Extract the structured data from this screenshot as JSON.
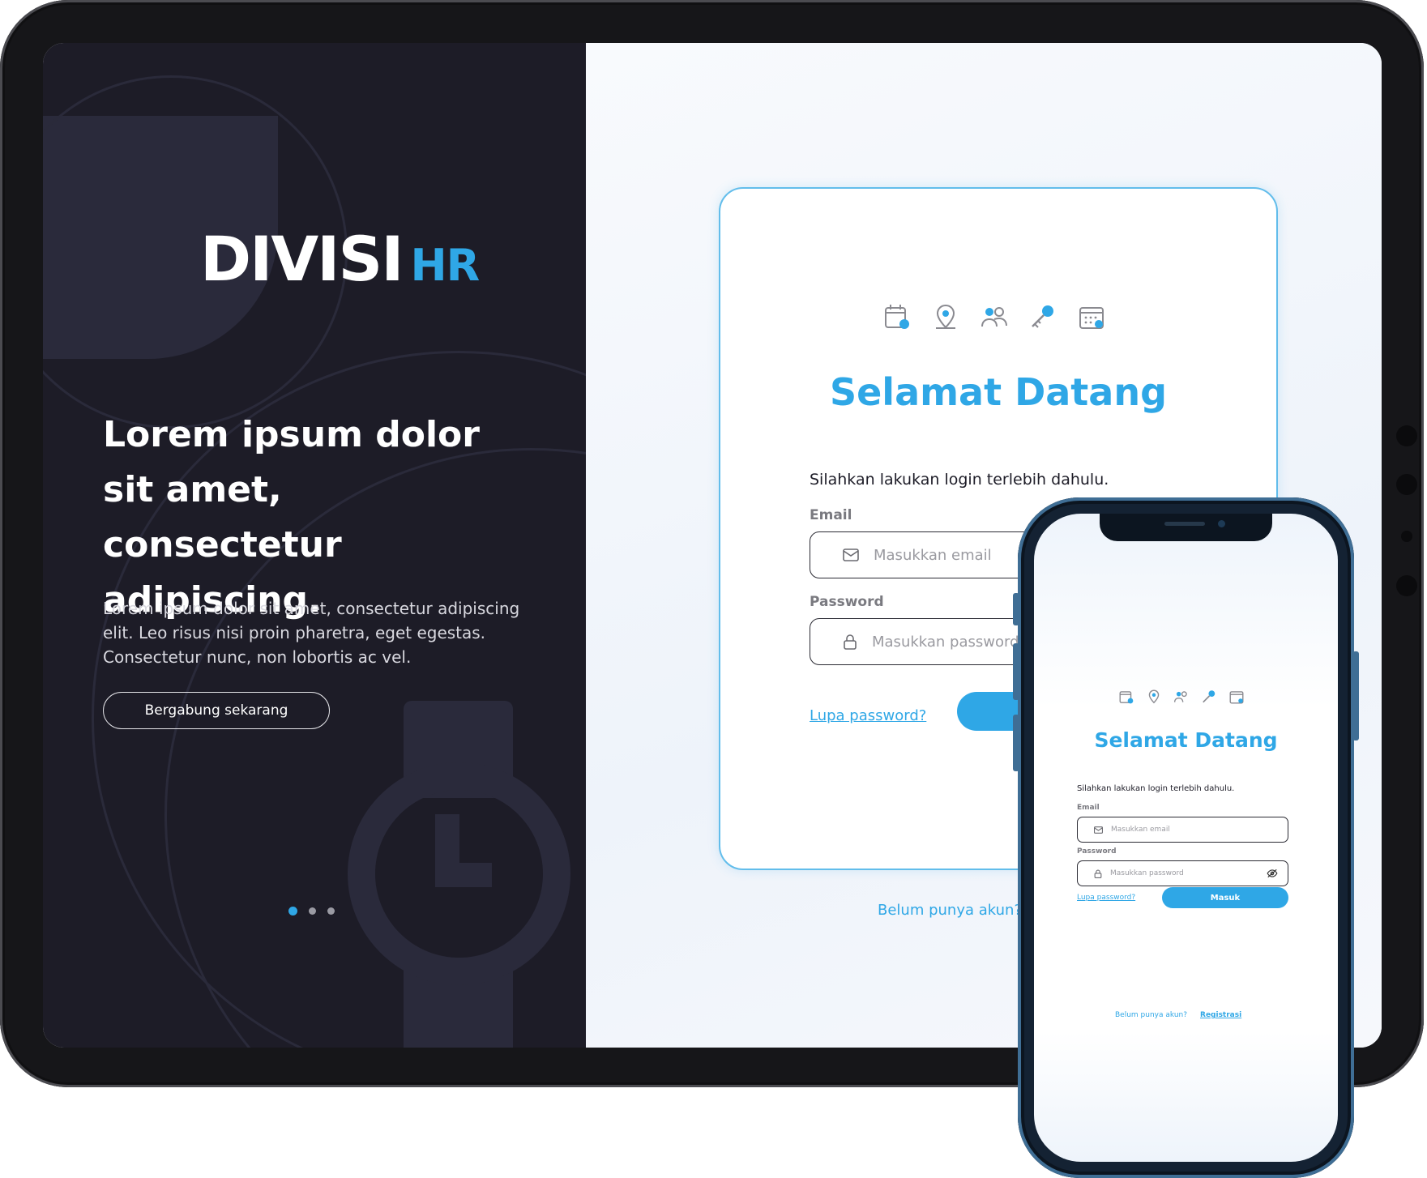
{
  "brand": {
    "logo_main": "DIVISI",
    "logo_accent": "HR"
  },
  "hero": {
    "title": "Lorem ipsum dolor sit amet, consectetur adipiscing.",
    "description": "Lorem ipsum dolor sit amet, consectetur adipiscing elit. Leo risus nisi proin pharetra, eget egestas. Consectetur nunc, non lobortis ac vel.",
    "cta_label": "Bergabung sekarang",
    "slides": 3,
    "active_slide": 1
  },
  "login": {
    "icons": [
      "calendar-clock-icon",
      "map-pin-icon",
      "users-icon",
      "key-icon",
      "calendar-grid-icon"
    ],
    "title": "Selamat Datang",
    "subtitle": "Silahkan lakukan login terlebih dahulu.",
    "email_label": "Email",
    "email_placeholder": "Masukkan email",
    "password_label": "Password",
    "password_placeholder": "Masukkan password",
    "forgot_label": "Lupa password?",
    "submit_label": "Masuk",
    "no_account_label": "Belum punya akun?",
    "register_label": "Registrasi"
  },
  "colors": {
    "accent": "#2fa7e6",
    "dark_panel": "#1d1c27",
    "deco": "#2a2a3b"
  }
}
